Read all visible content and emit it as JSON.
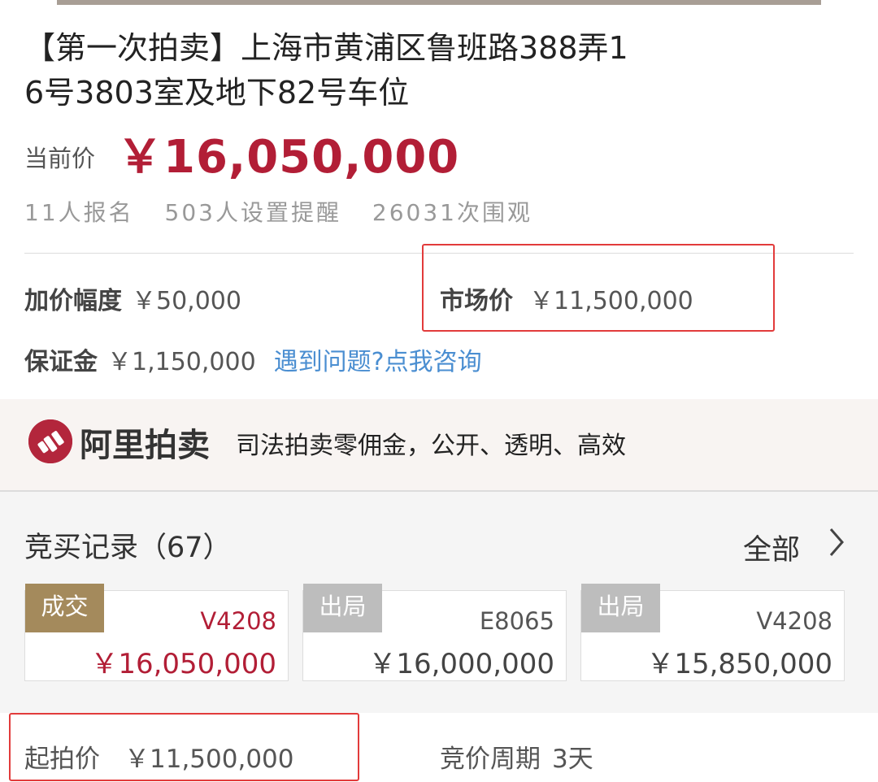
{
  "listing": {
    "title_line1": "【第一次拍卖】上海市黄浦区鲁班路388弄1",
    "title_line2": "6号3803室及地下82号车位",
    "current_price_label": "当前价",
    "current_price": "￥16,050,000",
    "stats": {
      "signups": "11人报名",
      "reminders": "503人设置提醒",
      "views": "26031次围观"
    },
    "increment_label": "加价幅度",
    "increment_value": "￥50,000",
    "market_price_label": "市场价",
    "market_price_value": "￥11,500,000",
    "deposit_label": "保证金",
    "deposit_value": "￥1,150,000",
    "consult_link": "遇到问题?点我咨询"
  },
  "banner": {
    "brand": "阿里拍卖",
    "slogan": "司法拍卖零佣金，公开、透明、高效"
  },
  "bid_records": {
    "title": "竞买记录（67）",
    "view_all": "全部",
    "items": [
      {
        "status": "成交",
        "bidder": "V4208",
        "amount": "￥16,050,000"
      },
      {
        "status": "出局",
        "bidder": "E8065",
        "amount": "￥16,000,000"
      },
      {
        "status": "出局",
        "bidder": "V4208",
        "amount": "￥15,850,000"
      }
    ]
  },
  "footer_info": {
    "start_price_label": "起拍价",
    "start_price_value": "￥11,500,000",
    "period_label": "竞价周期",
    "period_value": "3天"
  },
  "colors": {
    "price_red": "#b21e36",
    "link_blue": "#4a8ed1",
    "highlight_red": "#e23b3b",
    "win_badge": "#a48a5c",
    "out_badge": "#bdbdbd"
  }
}
